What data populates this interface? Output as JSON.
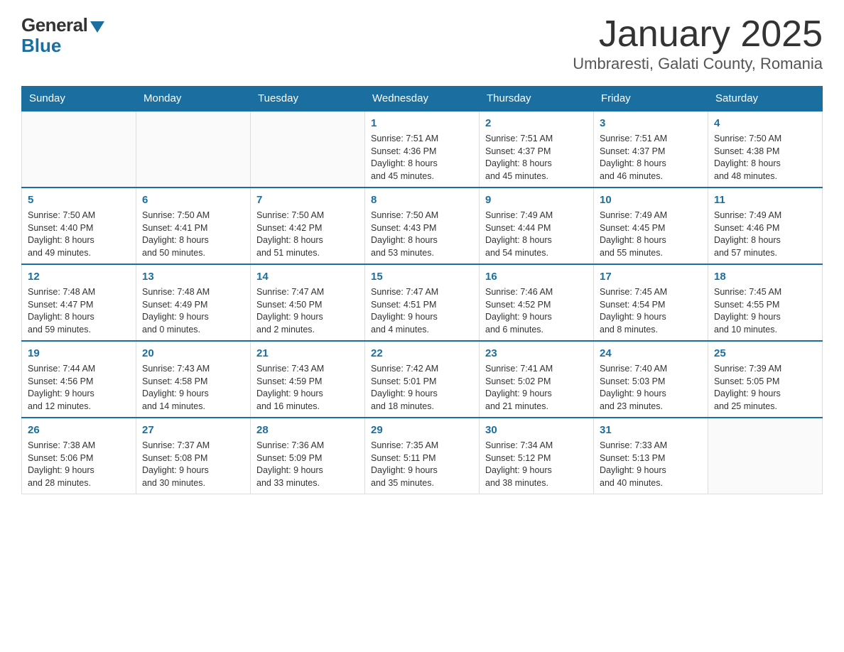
{
  "logo": {
    "general": "General",
    "blue": "Blue"
  },
  "title": "January 2025",
  "subtitle": "Umbraresti, Galati County, Romania",
  "days_of_week": [
    "Sunday",
    "Monday",
    "Tuesday",
    "Wednesday",
    "Thursday",
    "Friday",
    "Saturday"
  ],
  "weeks": [
    [
      {
        "day": "",
        "info": ""
      },
      {
        "day": "",
        "info": ""
      },
      {
        "day": "",
        "info": ""
      },
      {
        "day": "1",
        "info": "Sunrise: 7:51 AM\nSunset: 4:36 PM\nDaylight: 8 hours\nand 45 minutes."
      },
      {
        "day": "2",
        "info": "Sunrise: 7:51 AM\nSunset: 4:37 PM\nDaylight: 8 hours\nand 45 minutes."
      },
      {
        "day": "3",
        "info": "Sunrise: 7:51 AM\nSunset: 4:37 PM\nDaylight: 8 hours\nand 46 minutes."
      },
      {
        "day": "4",
        "info": "Sunrise: 7:50 AM\nSunset: 4:38 PM\nDaylight: 8 hours\nand 48 minutes."
      }
    ],
    [
      {
        "day": "5",
        "info": "Sunrise: 7:50 AM\nSunset: 4:40 PM\nDaylight: 8 hours\nand 49 minutes."
      },
      {
        "day": "6",
        "info": "Sunrise: 7:50 AM\nSunset: 4:41 PM\nDaylight: 8 hours\nand 50 minutes."
      },
      {
        "day": "7",
        "info": "Sunrise: 7:50 AM\nSunset: 4:42 PM\nDaylight: 8 hours\nand 51 minutes."
      },
      {
        "day": "8",
        "info": "Sunrise: 7:50 AM\nSunset: 4:43 PM\nDaylight: 8 hours\nand 53 minutes."
      },
      {
        "day": "9",
        "info": "Sunrise: 7:49 AM\nSunset: 4:44 PM\nDaylight: 8 hours\nand 54 minutes."
      },
      {
        "day": "10",
        "info": "Sunrise: 7:49 AM\nSunset: 4:45 PM\nDaylight: 8 hours\nand 55 minutes."
      },
      {
        "day": "11",
        "info": "Sunrise: 7:49 AM\nSunset: 4:46 PM\nDaylight: 8 hours\nand 57 minutes."
      }
    ],
    [
      {
        "day": "12",
        "info": "Sunrise: 7:48 AM\nSunset: 4:47 PM\nDaylight: 8 hours\nand 59 minutes."
      },
      {
        "day": "13",
        "info": "Sunrise: 7:48 AM\nSunset: 4:49 PM\nDaylight: 9 hours\nand 0 minutes."
      },
      {
        "day": "14",
        "info": "Sunrise: 7:47 AM\nSunset: 4:50 PM\nDaylight: 9 hours\nand 2 minutes."
      },
      {
        "day": "15",
        "info": "Sunrise: 7:47 AM\nSunset: 4:51 PM\nDaylight: 9 hours\nand 4 minutes."
      },
      {
        "day": "16",
        "info": "Sunrise: 7:46 AM\nSunset: 4:52 PM\nDaylight: 9 hours\nand 6 minutes."
      },
      {
        "day": "17",
        "info": "Sunrise: 7:45 AM\nSunset: 4:54 PM\nDaylight: 9 hours\nand 8 minutes."
      },
      {
        "day": "18",
        "info": "Sunrise: 7:45 AM\nSunset: 4:55 PM\nDaylight: 9 hours\nand 10 minutes."
      }
    ],
    [
      {
        "day": "19",
        "info": "Sunrise: 7:44 AM\nSunset: 4:56 PM\nDaylight: 9 hours\nand 12 minutes."
      },
      {
        "day": "20",
        "info": "Sunrise: 7:43 AM\nSunset: 4:58 PM\nDaylight: 9 hours\nand 14 minutes."
      },
      {
        "day": "21",
        "info": "Sunrise: 7:43 AM\nSunset: 4:59 PM\nDaylight: 9 hours\nand 16 minutes."
      },
      {
        "day": "22",
        "info": "Sunrise: 7:42 AM\nSunset: 5:01 PM\nDaylight: 9 hours\nand 18 minutes."
      },
      {
        "day": "23",
        "info": "Sunrise: 7:41 AM\nSunset: 5:02 PM\nDaylight: 9 hours\nand 21 minutes."
      },
      {
        "day": "24",
        "info": "Sunrise: 7:40 AM\nSunset: 5:03 PM\nDaylight: 9 hours\nand 23 minutes."
      },
      {
        "day": "25",
        "info": "Sunrise: 7:39 AM\nSunset: 5:05 PM\nDaylight: 9 hours\nand 25 minutes."
      }
    ],
    [
      {
        "day": "26",
        "info": "Sunrise: 7:38 AM\nSunset: 5:06 PM\nDaylight: 9 hours\nand 28 minutes."
      },
      {
        "day": "27",
        "info": "Sunrise: 7:37 AM\nSunset: 5:08 PM\nDaylight: 9 hours\nand 30 minutes."
      },
      {
        "day": "28",
        "info": "Sunrise: 7:36 AM\nSunset: 5:09 PM\nDaylight: 9 hours\nand 33 minutes."
      },
      {
        "day": "29",
        "info": "Sunrise: 7:35 AM\nSunset: 5:11 PM\nDaylight: 9 hours\nand 35 minutes."
      },
      {
        "day": "30",
        "info": "Sunrise: 7:34 AM\nSunset: 5:12 PM\nDaylight: 9 hours\nand 38 minutes."
      },
      {
        "day": "31",
        "info": "Sunrise: 7:33 AM\nSunset: 5:13 PM\nDaylight: 9 hours\nand 40 minutes."
      },
      {
        "day": "",
        "info": ""
      }
    ]
  ]
}
